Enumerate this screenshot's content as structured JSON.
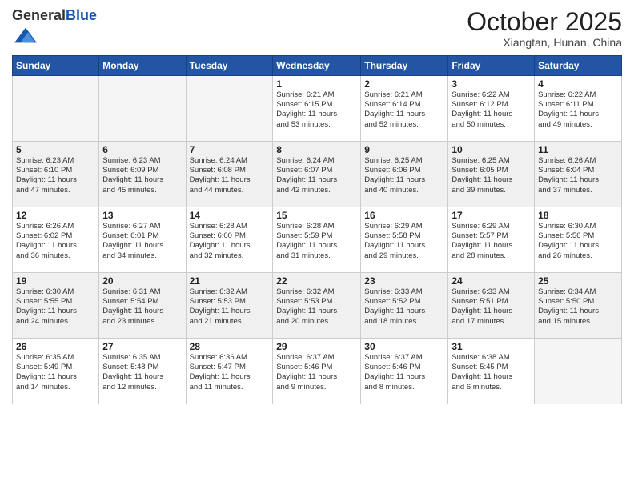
{
  "header": {
    "logo_general": "General",
    "logo_blue": "Blue",
    "month_title": "October 2025",
    "location": "Xiangtan, Hunan, China"
  },
  "weekdays": [
    "Sunday",
    "Monday",
    "Tuesday",
    "Wednesday",
    "Thursday",
    "Friday",
    "Saturday"
  ],
  "weeks": [
    [
      {
        "day": "",
        "info": ""
      },
      {
        "day": "",
        "info": ""
      },
      {
        "day": "",
        "info": ""
      },
      {
        "day": "1",
        "info": "Sunrise: 6:21 AM\nSunset: 6:15 PM\nDaylight: 11 hours\nand 53 minutes."
      },
      {
        "day": "2",
        "info": "Sunrise: 6:21 AM\nSunset: 6:14 PM\nDaylight: 11 hours\nand 52 minutes."
      },
      {
        "day": "3",
        "info": "Sunrise: 6:22 AM\nSunset: 6:12 PM\nDaylight: 11 hours\nand 50 minutes."
      },
      {
        "day": "4",
        "info": "Sunrise: 6:22 AM\nSunset: 6:11 PM\nDaylight: 11 hours\nand 49 minutes."
      }
    ],
    [
      {
        "day": "5",
        "info": "Sunrise: 6:23 AM\nSunset: 6:10 PM\nDaylight: 11 hours\nand 47 minutes."
      },
      {
        "day": "6",
        "info": "Sunrise: 6:23 AM\nSunset: 6:09 PM\nDaylight: 11 hours\nand 45 minutes."
      },
      {
        "day": "7",
        "info": "Sunrise: 6:24 AM\nSunset: 6:08 PM\nDaylight: 11 hours\nand 44 minutes."
      },
      {
        "day": "8",
        "info": "Sunrise: 6:24 AM\nSunset: 6:07 PM\nDaylight: 11 hours\nand 42 minutes."
      },
      {
        "day": "9",
        "info": "Sunrise: 6:25 AM\nSunset: 6:06 PM\nDaylight: 11 hours\nand 40 minutes."
      },
      {
        "day": "10",
        "info": "Sunrise: 6:25 AM\nSunset: 6:05 PM\nDaylight: 11 hours\nand 39 minutes."
      },
      {
        "day": "11",
        "info": "Sunrise: 6:26 AM\nSunset: 6:04 PM\nDaylight: 11 hours\nand 37 minutes."
      }
    ],
    [
      {
        "day": "12",
        "info": "Sunrise: 6:26 AM\nSunset: 6:02 PM\nDaylight: 11 hours\nand 36 minutes."
      },
      {
        "day": "13",
        "info": "Sunrise: 6:27 AM\nSunset: 6:01 PM\nDaylight: 11 hours\nand 34 minutes."
      },
      {
        "day": "14",
        "info": "Sunrise: 6:28 AM\nSunset: 6:00 PM\nDaylight: 11 hours\nand 32 minutes."
      },
      {
        "day": "15",
        "info": "Sunrise: 6:28 AM\nSunset: 5:59 PM\nDaylight: 11 hours\nand 31 minutes."
      },
      {
        "day": "16",
        "info": "Sunrise: 6:29 AM\nSunset: 5:58 PM\nDaylight: 11 hours\nand 29 minutes."
      },
      {
        "day": "17",
        "info": "Sunrise: 6:29 AM\nSunset: 5:57 PM\nDaylight: 11 hours\nand 28 minutes."
      },
      {
        "day": "18",
        "info": "Sunrise: 6:30 AM\nSunset: 5:56 PM\nDaylight: 11 hours\nand 26 minutes."
      }
    ],
    [
      {
        "day": "19",
        "info": "Sunrise: 6:30 AM\nSunset: 5:55 PM\nDaylight: 11 hours\nand 24 minutes."
      },
      {
        "day": "20",
        "info": "Sunrise: 6:31 AM\nSunset: 5:54 PM\nDaylight: 11 hours\nand 23 minutes."
      },
      {
        "day": "21",
        "info": "Sunrise: 6:32 AM\nSunset: 5:53 PM\nDaylight: 11 hours\nand 21 minutes."
      },
      {
        "day": "22",
        "info": "Sunrise: 6:32 AM\nSunset: 5:53 PM\nDaylight: 11 hours\nand 20 minutes."
      },
      {
        "day": "23",
        "info": "Sunrise: 6:33 AM\nSunset: 5:52 PM\nDaylight: 11 hours\nand 18 minutes."
      },
      {
        "day": "24",
        "info": "Sunrise: 6:33 AM\nSunset: 5:51 PM\nDaylight: 11 hours\nand 17 minutes."
      },
      {
        "day": "25",
        "info": "Sunrise: 6:34 AM\nSunset: 5:50 PM\nDaylight: 11 hours\nand 15 minutes."
      }
    ],
    [
      {
        "day": "26",
        "info": "Sunrise: 6:35 AM\nSunset: 5:49 PM\nDaylight: 11 hours\nand 14 minutes."
      },
      {
        "day": "27",
        "info": "Sunrise: 6:35 AM\nSunset: 5:48 PM\nDaylight: 11 hours\nand 12 minutes."
      },
      {
        "day": "28",
        "info": "Sunrise: 6:36 AM\nSunset: 5:47 PM\nDaylight: 11 hours\nand 11 minutes."
      },
      {
        "day": "29",
        "info": "Sunrise: 6:37 AM\nSunset: 5:46 PM\nDaylight: 11 hours\nand 9 minutes."
      },
      {
        "day": "30",
        "info": "Sunrise: 6:37 AM\nSunset: 5:46 PM\nDaylight: 11 hours\nand 8 minutes."
      },
      {
        "day": "31",
        "info": "Sunrise: 6:38 AM\nSunset: 5:45 PM\nDaylight: 11 hours\nand 6 minutes."
      },
      {
        "day": "",
        "info": ""
      }
    ]
  ]
}
